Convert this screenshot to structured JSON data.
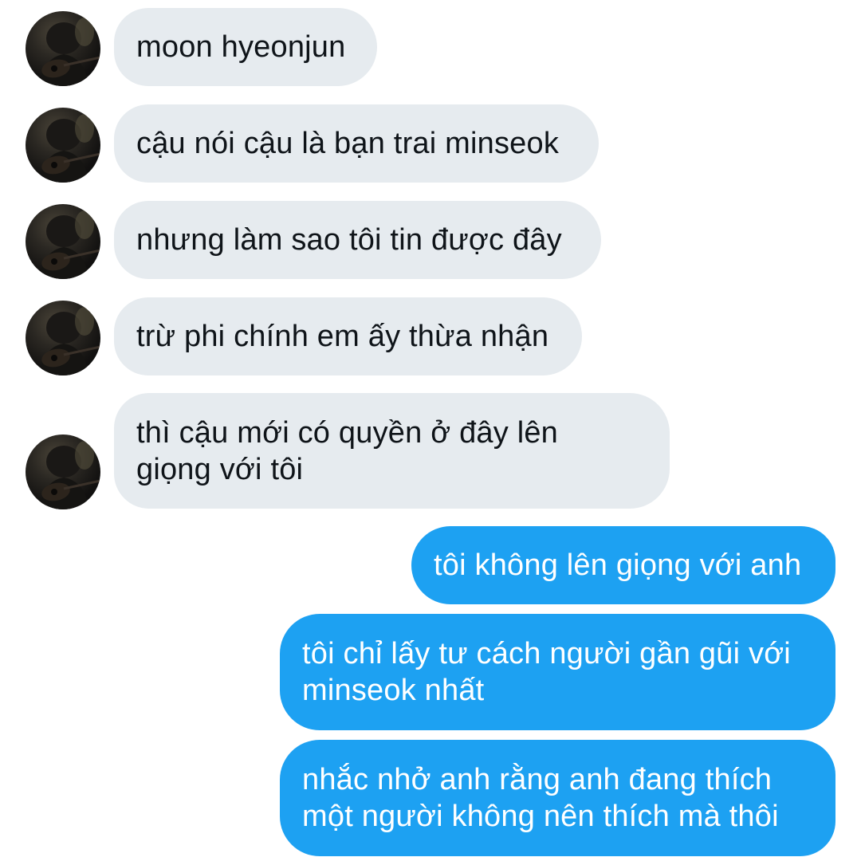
{
  "conversation": {
    "incoming": [
      {
        "text": "moon hyeonjun"
      },
      {
        "text": "cậu nói cậu là bạn trai minseok"
      },
      {
        "text": "nhưng làm sao tôi tin được đây"
      },
      {
        "text": "trừ phi chính em ấy thừa nhận"
      },
      {
        "text": "thì cậu mới có quyền ở đây lên\ngiọng với tôi"
      }
    ],
    "outgoing": [
      {
        "text": "tôi không lên giọng với anh"
      },
      {
        "text": "tôi chỉ lấy tư cách người gần gũi với\nminseok nhất"
      },
      {
        "text": "nhắc nhở anh rằng anh đang thích\nmột người không nên thích mà thôi"
      }
    ]
  },
  "colors": {
    "incoming_bubble": "#e6ebef",
    "outgoing_bubble": "#1da1f2",
    "incoming_text": "#0f1419",
    "outgoing_text": "#ffffff"
  },
  "icons": {
    "avatar": "avatar"
  }
}
